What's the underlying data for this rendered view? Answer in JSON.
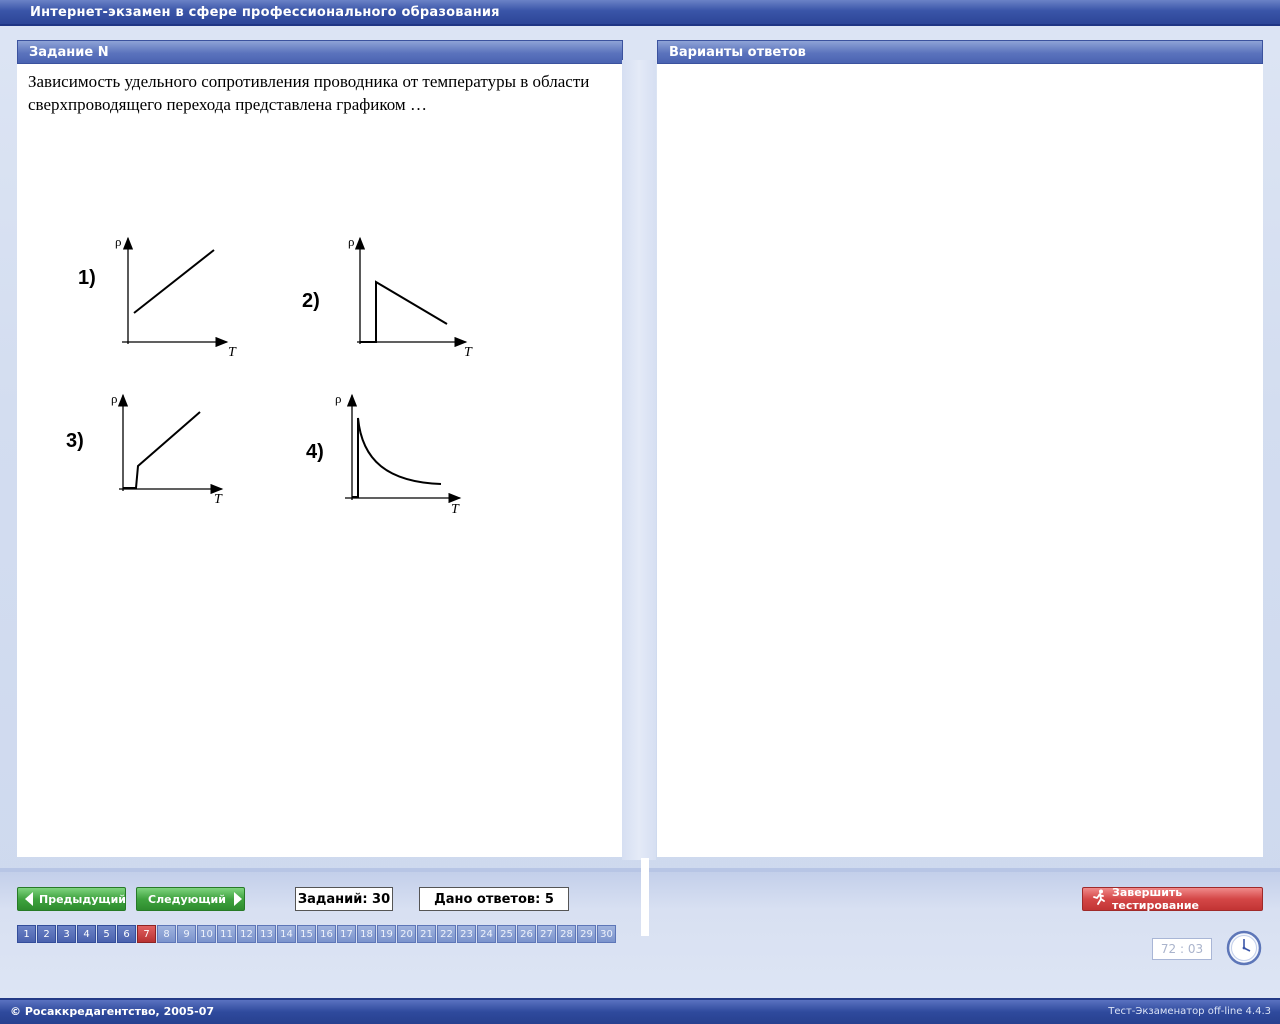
{
  "window": {
    "title": "Интернет-экзамен в сфере профессионального образования"
  },
  "question_panel": {
    "header": "Задание N",
    "text": "Зависимость удельного сопротивления проводника от температуры в области сверхпроводящего перехода представлена графиком …",
    "graphs": [
      {
        "label": "1)",
        "y_axis": "ρ",
        "x_axis": "T"
      },
      {
        "label": "2)",
        "y_axis": "ρ",
        "x_axis": "T"
      },
      {
        "label": "3)",
        "y_axis": "ρ",
        "x_axis": "T"
      },
      {
        "label": "4)",
        "y_axis": "ρ",
        "x_axis": "T"
      }
    ]
  },
  "answers_panel": {
    "header": "Варианты ответов"
  },
  "navigation": {
    "prev_label": "Предыдущий",
    "next_label": "Следующий",
    "tasks_count": "Заданий: 30",
    "answers_given": "Дано ответов: 5",
    "finish_label": "Завершить тестирование",
    "pages": [
      "1",
      "2",
      "3",
      "4",
      "5",
      "6",
      "7",
      "8",
      "9",
      "10",
      "11",
      "12",
      "13",
      "14",
      "15",
      "16",
      "17",
      "18",
      "19",
      "20",
      "21",
      "22",
      "23",
      "24",
      "25",
      "26",
      "27",
      "28",
      "29",
      "30"
    ],
    "answered_pages": [
      "1",
      "2",
      "3",
      "4",
      "5",
      "6"
    ],
    "current_page": "7"
  },
  "timer": {
    "value": "72 : 03"
  },
  "statusbar": {
    "copyright": "© Росаккредагентство, 2005-07",
    "version": "Тест-Экзаменатор off-line 4.4.3"
  },
  "colors": {
    "title_bar": "#3a55a8",
    "panel_header": "#5b73bd",
    "nav_button": "#3fa33f",
    "finish_button": "#d44747",
    "current_page": "#b83232"
  }
}
